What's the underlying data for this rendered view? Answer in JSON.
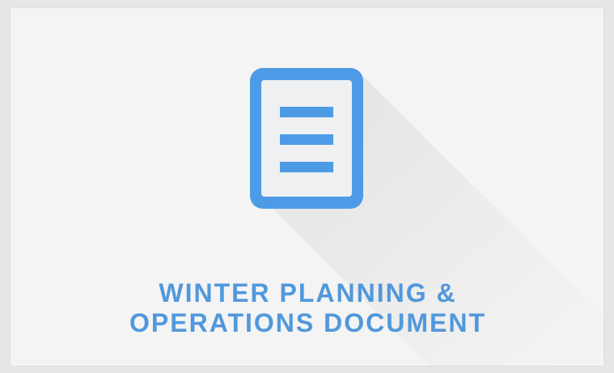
{
  "card": {
    "title_line1": "WINTER PLANNING &",
    "title_line2": "OPERATIONS DOCUMENT",
    "icon": "document-icon",
    "accent_color": "#5198dc",
    "icon_color": "#4d9be6",
    "icon_inner_color": "#eef0f2",
    "background_color": "#f4f4f4"
  }
}
